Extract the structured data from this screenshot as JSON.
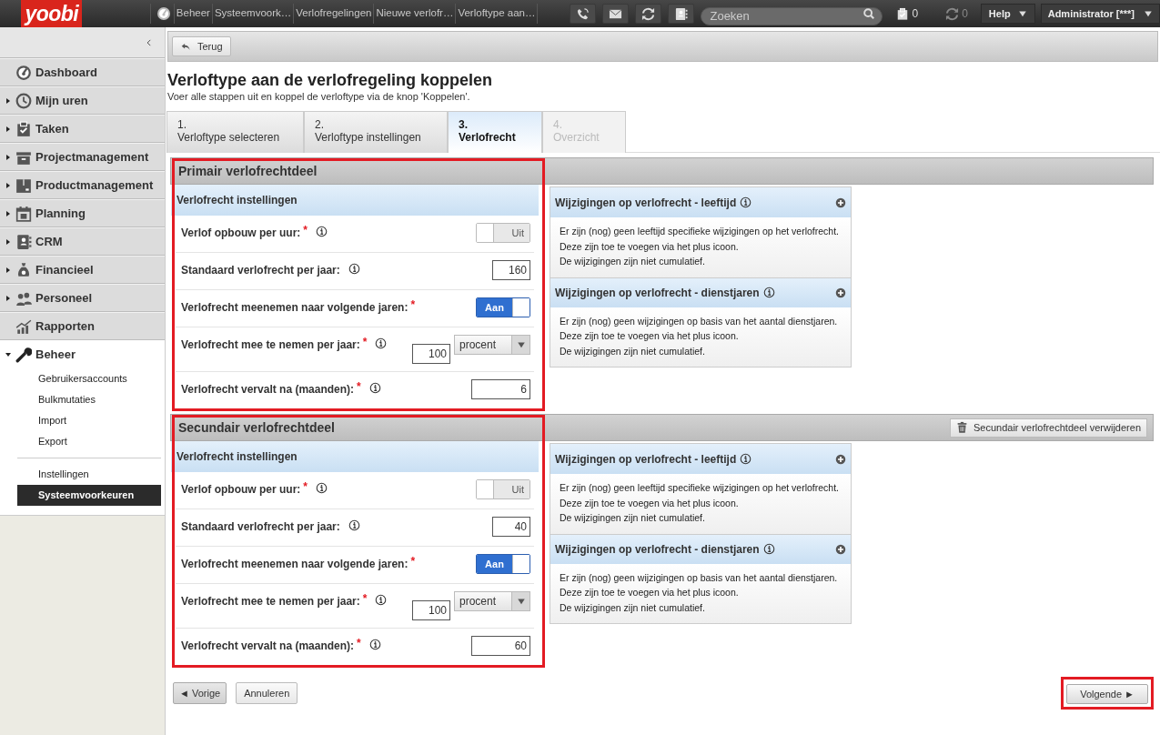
{
  "top_bar": {
    "logo": "yoobi",
    "breadcrumb": [
      "Beheer",
      "Systeemvoork…",
      "Verlofregelingen",
      "Nieuwe verlofr…",
      "Verloftype aan…"
    ],
    "search": {
      "placeholder": "Zoeken"
    },
    "tasks_count": "0",
    "sync_count": "0",
    "help": "Help",
    "user": "Administrator [***]"
  },
  "sidebar": {
    "items": [
      {
        "label": "Dashboard"
      },
      {
        "label": "Mijn uren",
        "expanded": false
      },
      {
        "label": "Taken",
        "expanded": false
      },
      {
        "label": "Projectmanagement",
        "expanded": false
      },
      {
        "label": "Productmanagement",
        "expanded": false
      },
      {
        "label": "Planning",
        "expanded": false
      },
      {
        "label": "CRM",
        "expanded": false
      },
      {
        "label": "Financieel",
        "expanded": false
      },
      {
        "label": "Personeel",
        "expanded": false
      },
      {
        "label": "Rapporten"
      },
      {
        "label": "Beheer",
        "expanded": true,
        "children": [
          {
            "label": "Gebruikersaccounts",
            "selected": false,
            "divider_before": false
          },
          {
            "label": "Bulkmutaties",
            "selected": false,
            "divider_before": false
          },
          {
            "label": "Import",
            "selected": false,
            "divider_before": false
          },
          {
            "label": "Export",
            "selected": false,
            "divider_before": false
          },
          {
            "label": "Instellingen",
            "selected": false,
            "divider_before": true
          },
          {
            "label": "Systeemvoorkeuren",
            "selected": true,
            "divider_before": false
          }
        ]
      }
    ]
  },
  "back_button": "Terug",
  "title": "Verloftype aan de verlofregeling koppelen",
  "subtitle": "Voer alle stappen uit en koppel de verloftype via de knop 'Koppelen'.",
  "tabs": [
    {
      "number": "1.",
      "label": "Verloftype selecteren",
      "selected": false,
      "disabled": false
    },
    {
      "number": "2.",
      "label": "Verloftype instellingen",
      "selected": false,
      "disabled": false
    },
    {
      "number": "3.",
      "label": "Verlofrecht",
      "selected": true,
      "disabled": false
    },
    {
      "number": "4.",
      "label": "Overzicht",
      "selected": false,
      "disabled": true
    }
  ],
  "sections": [
    {
      "title": "Primair verlofrechtdeel",
      "highlighted": true,
      "settings_title": "Verlofrecht instellingen",
      "rows": [
        {
          "kind": "toggle",
          "label": "Verlof opbouw per uur:",
          "required_mark": "*",
          "info": true,
          "on": false,
          "value": "Uit"
        },
        {
          "kind": "number",
          "label": "Standaard verlofrecht per jaar:",
          "info": true,
          "value": "160"
        },
        {
          "kind": "toggle",
          "label": "Verlofrecht meenemen naar volgende jaren:",
          "required_mark": "*",
          "on": true,
          "value": "Aan"
        },
        {
          "kind": "number_unit",
          "label": "Verlofrecht mee te nemen per jaar:",
          "required_mark": "*",
          "info": true,
          "value": "100",
          "unit": "procent"
        },
        {
          "kind": "number",
          "label": "Verlofrecht vervalt na (maanden):",
          "required_mark": "*",
          "info": true,
          "value": "6"
        }
      ],
      "panels": [
        {
          "title": "Wijzigingen op verlofrecht - leeftijd",
          "lines": [
            "Er zijn (nog) geen leeftijd specifieke wijzigingen op het verlofrecht.",
            "Deze zijn toe te voegen via het plus icoon.",
            "De wijzigingen zijn niet cumulatief."
          ]
        },
        {
          "title": "Wijzigingen op verlofrecht - dienstjaren",
          "lines": [
            "Er zijn (nog) geen wijzigingen op basis van het aantal dienstjaren.",
            "Deze zijn toe te voegen via het plus icoon.",
            "De wijzigingen zijn niet cumulatief."
          ]
        }
      ]
    },
    {
      "title": "Secundair verlofrechtdeel",
      "highlighted": true,
      "delete_button": "Secundair verlofrechtdeel verwijderen",
      "settings_title": "Verlofrecht instellingen",
      "rows": [
        {
          "kind": "toggle",
          "label": "Verlof opbouw per uur:",
          "required_mark": "*",
          "info": true,
          "on": false,
          "value": "Uit"
        },
        {
          "kind": "number",
          "label": "Standaard verlofrecht per jaar:",
          "info": true,
          "value": "40"
        },
        {
          "kind": "toggle",
          "label": "Verlofrecht meenemen naar volgende jaren:",
          "required_mark": "*",
          "on": true,
          "value": "Aan"
        },
        {
          "kind": "number_unit",
          "label": "Verlofrecht mee te nemen per jaar:",
          "required_mark": "*",
          "info": true,
          "value": "100",
          "unit": "procent"
        },
        {
          "kind": "number",
          "label": "Verlofrecht vervalt na (maanden):",
          "required_mark": "*",
          "info": true,
          "value": "60"
        }
      ],
      "panels": [
        {
          "title": "Wijzigingen op verlofrecht - leeftijd",
          "lines": [
            "Er zijn (nog) geen leeftijd specifieke wijzigingen op het verlofrecht.",
            "Deze zijn toe te voegen via het plus icoon.",
            "De wijzigingen zijn niet cumulatief."
          ]
        },
        {
          "title": "Wijzigingen op verlofrecht - dienstjaren",
          "lines": [
            "Er zijn (nog) geen wijzigingen op basis van het aantal dienstjaren.",
            "Deze zijn toe te voegen via het plus icoon.",
            "De wijzigingen zijn niet cumulatief."
          ]
        }
      ]
    }
  ],
  "footer": {
    "previous": "◄ Vorige",
    "cancel": "Annuleren",
    "next": "Volgende ►",
    "next_highlighted": true
  }
}
